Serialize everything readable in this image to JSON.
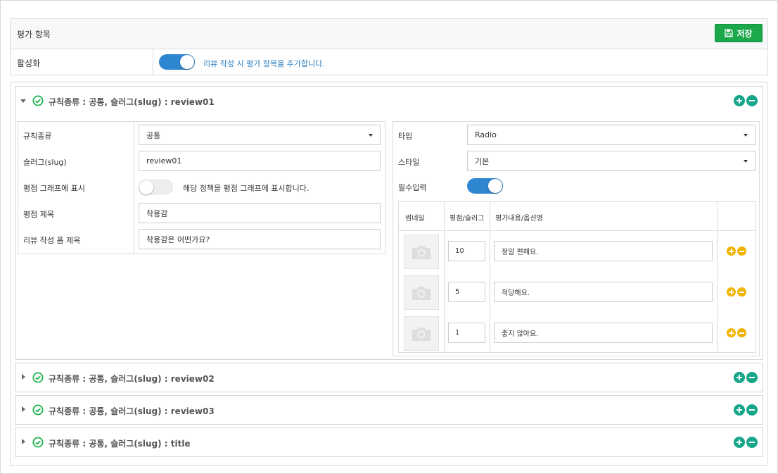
{
  "header": {
    "title": "평가 항목",
    "save_label": "저장",
    "activation_label": "활성화",
    "activation_on": true,
    "activation_desc": "리뷰 작성 시 평가 항목을 추가합니다."
  },
  "rules": [
    {
      "title": "규칙종류 : 공통, 슬러그(slug) : review01",
      "expanded": true
    },
    {
      "title": "규칙종류 : 공통, 슬러그(slug) : review02",
      "expanded": false
    },
    {
      "title": "규칙종류 : 공통, 슬러그(slug) : review03",
      "expanded": false
    },
    {
      "title": "규칙종류 : 공통, 슬러그(slug) : title",
      "expanded": false
    }
  ],
  "detail": {
    "rule_type_label": "규칙종류",
    "rule_type_value": "공통",
    "slug_label": "슬러그(slug)",
    "slug_value": "review01",
    "graph_label": "평점 그래프에 표시",
    "graph_on": false,
    "graph_desc": "해당 정책을 평점 그래프에 표시합니다.",
    "score_title_label": "평점 제목",
    "score_title_value": "착용감",
    "form_title_label": "리뷰 작성 폼 제목",
    "form_title_value": "착용감은 어떤가요?",
    "type_label": "타입",
    "type_value": "Radio",
    "style_label": "스타일",
    "style_value": "기본",
    "required_label": "필수입력",
    "required_on": true,
    "table_headers": [
      "썸네일",
      "평점/슬러그",
      "평가내용/옵션명"
    ],
    "options": [
      {
        "score": "10",
        "text": "정말 편해요."
      },
      {
        "score": "5",
        "text": "적당해요."
      },
      {
        "score": "1",
        "text": "좋지 않아요."
      }
    ]
  },
  "colors": {
    "save_green": "#1aa84b",
    "toggle_blue": "#2f86d0",
    "teal_action": "#16a68a",
    "gold_action": "#f0b400",
    "check_green": "#1db34b"
  },
  "icons": {
    "save": "floppy-disk-icon",
    "check": "check-circle-icon",
    "add": "plus-circle-icon",
    "remove": "minus-circle-icon",
    "thumb": "camera-icon"
  }
}
